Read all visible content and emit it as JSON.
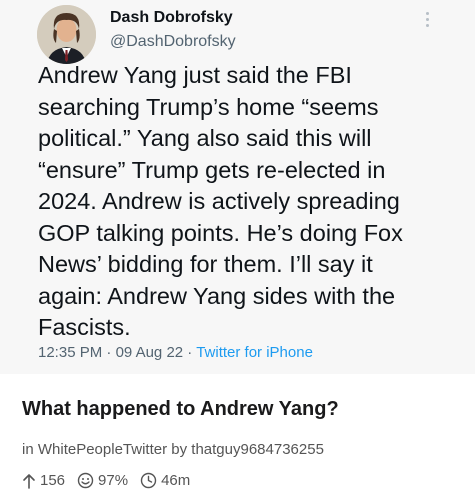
{
  "tweet": {
    "author_name": "Dash Dobrofsky",
    "author_handle": "@DashDobrofsky",
    "text": "Andrew Yang just said the FBI\nsearching Trump’s home “seems\npolitical.” Yang also said this will\n“ensure” Trump gets re-elected in\n2024. Andrew is actively spreading\nGOP talking points. He’s doing Fox\nNews’ bidding for them. I’ll say it\nagain: Andrew Yang sides with the\nFascists.",
    "time": "12:35 PM",
    "sep1": " · ",
    "date": "09 Aug 22",
    "sep2": " · ",
    "source": "Twitter for iPhone",
    "more_icon": "vertical-ellipsis-icon"
  },
  "post": {
    "title": "What happened to Andrew Yang?",
    "in_label": "in",
    "subreddit": "WhitePeopleTwitter",
    "by_label": "by",
    "author": "thatguy9684736255",
    "upvotes": "156",
    "ratio": "97%",
    "age": "46m",
    "icons": [
      "up-arrow-icon",
      "smiley-icon",
      "clock-icon"
    ]
  },
  "colors": {
    "tweet_background": "#f7f7f7",
    "handle_gray": "#536471",
    "link_blue": "#1d9bf0",
    "text_dark": "#0f1419"
  }
}
